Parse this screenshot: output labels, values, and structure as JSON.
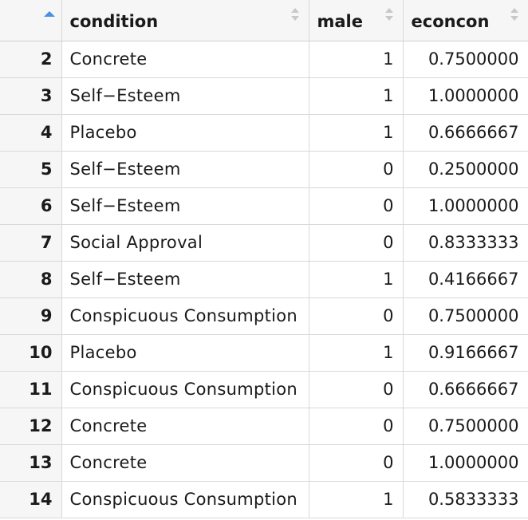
{
  "table": {
    "columns": [
      {
        "label": "",
        "sort": "asc"
      },
      {
        "label": "condition",
        "sort": "none"
      },
      {
        "label": "male",
        "sort": "none"
      },
      {
        "label": "econcon",
        "sort": "none"
      }
    ],
    "rows": [
      {
        "index": "2",
        "condition": "Concrete",
        "male": "1",
        "econcon": "0.7500000"
      },
      {
        "index": "3",
        "condition": "Self−Esteem",
        "male": "1",
        "econcon": "1.0000000"
      },
      {
        "index": "4",
        "condition": "Placebo",
        "male": "1",
        "econcon": "0.6666667"
      },
      {
        "index": "5",
        "condition": "Self−Esteem",
        "male": "0",
        "econcon": "0.2500000"
      },
      {
        "index": "6",
        "condition": "Self−Esteem",
        "male": "0",
        "econcon": "1.0000000"
      },
      {
        "index": "7",
        "condition": "Social Approval",
        "male": "0",
        "econcon": "0.8333333"
      },
      {
        "index": "8",
        "condition": "Self−Esteem",
        "male": "1",
        "econcon": "0.4166667"
      },
      {
        "index": "9",
        "condition": "Conspicuous Consumption",
        "male": "0",
        "econcon": "0.7500000"
      },
      {
        "index": "10",
        "condition": "Placebo",
        "male": "1",
        "econcon": "0.9166667"
      },
      {
        "index": "11",
        "condition": "Conspicuous Consumption",
        "male": "0",
        "econcon": "0.6666667"
      },
      {
        "index": "12",
        "condition": "Concrete",
        "male": "0",
        "econcon": "0.7500000"
      },
      {
        "index": "13",
        "condition": "Concrete",
        "male": "0",
        "econcon": "1.0000000"
      },
      {
        "index": "14",
        "condition": "Conspicuous Consumption",
        "male": "1",
        "econcon": "0.5833333"
      }
    ]
  },
  "colors": {
    "sort_active": "#4a90e2",
    "sort_inactive": "#c8c8c8",
    "header_bg": "#f6f6f6",
    "grid_line": "#d9d9d9"
  }
}
